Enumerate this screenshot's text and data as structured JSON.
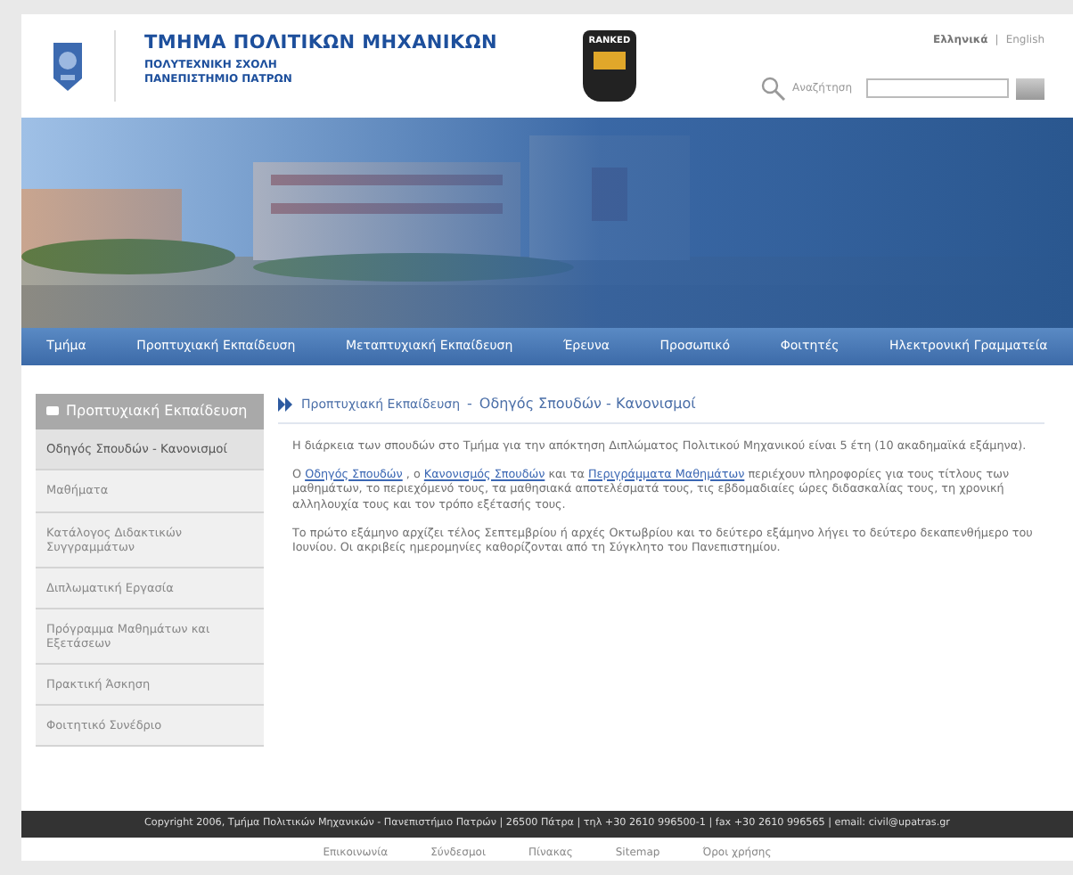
{
  "header": {
    "title": "ΤΜΗΜΑ ΠΟΛΙΤΙΚΩΝ ΜΗΧΑΝΙΚΩΝ",
    "subtitle_lines": [
      "ΠΟΛΥΤΕΧΝΙΚΗ ΣΧΟΛΗ",
      "ΠΑΝΕΠΙΣΤΗΜΙΟ ΠΑΤΡΩΝ"
    ],
    "badge": "RANKED",
    "languages": [
      {
        "label": "Ελληνικά",
        "selected": true
      },
      {
        "label": "English",
        "selected": false
      }
    ],
    "language_separator": "|",
    "search": {
      "label": "Αναζήτηση"
    }
  },
  "banner": {
    "kind": "picture"
  },
  "nav": [
    "Τμήμα",
    "Προπτυχιακή Εκπαίδευση",
    "Μεταπτυχιακή Εκπαίδευση",
    "Έρευνα",
    "Προσωπικό",
    "Φοιτητές",
    "Ηλεκτρονική Γραμματεία"
  ],
  "sidebar": {
    "title": "Προπτυχιακή Εκπαίδευση",
    "expanded": true,
    "items": [
      {
        "label": "Οδηγός Σπουδών - Κανονισμοί",
        "selected": true
      },
      {
        "label": "Μαθήματα",
        "selected": false
      },
      {
        "label": "Κατάλογος Διδακτικών Συγγραμμάτων",
        "selected": false
      },
      {
        "label": "Διπλωματική Εργασία",
        "selected": false
      },
      {
        "label": "Πρόγραμμα Μαθημάτων και Εξετάσεων",
        "selected": false
      },
      {
        "label": "Πρακτική Άσκηση",
        "selected": false
      },
      {
        "label": "Φοιτητικό Συνέδριο",
        "selected": false
      }
    ]
  },
  "breadcrumb_separator": "-",
  "breadcrumb": [
    {
      "label": "Προπτυχιακή Εκπαίδευση",
      "kind": "link"
    },
    {
      "label": "Οδηγός Σπουδών - Κανονισμοί",
      "kind": "current"
    }
  ],
  "paragraphs": [
    [
      {
        "kind": "text",
        "text": "Η διάρκεια των σπουδών στο Τμήμα για την απόκτηση Διπλώματος Πολιτικού Μηχανικού είναι 5 έτη (10 ακαδημαϊκά εξάμηνα)."
      }
    ],
    [
      {
        "kind": "text",
        "text": "Ο "
      },
      {
        "kind": "link",
        "text": "Οδηγός Σπουδών"
      },
      {
        "kind": "text",
        "text": " , ο "
      },
      {
        "kind": "link",
        "text": "Κανονισμός Σπουδών"
      },
      {
        "kind": "text",
        "text": " και τα "
      },
      {
        "kind": "link",
        "text": "Περιγράμματα Μαθημάτων"
      },
      {
        "kind": "text",
        "text": " περιέχουν πληροφορίες για τους τίτλους των μαθημάτων, το περιεχόμενό τους, τα μαθησιακά αποτελέσματά τους, τις εβδομαδιαίες ώρες διδασκαλίας τους, τη χρονική αλληλουχία τους και τον τρόπο εξέτασής τους."
      }
    ],
    [
      {
        "kind": "text",
        "text": "Το πρώτο εξάμηνο αρχίζει τέλος Σεπτεμβρίου ή αρχές Οκτωβρίου και το δεύτερο εξάμηνο λήγει το δεύτερο δεκαπενθήμερο του Ιουνίου. Οι ακριβείς ημερομηνίες καθορίζονται από τη Σύγκλητο του Πανεπιστημίου."
      }
    ]
  ],
  "footer": {
    "text": "Copyright 2006, Τμήμα Πολιτικών Μηχανικών - Πανεπιστήμιο Πατρών | 26500 Πάτρα | τηλ +30 2610 996500-1 | fax +30 2610 996565 | email: civil@upatras.gr",
    "links": [
      "Επικοινωνία",
      "Σύνδεσμοι",
      "Πίνακας",
      "Sitemap",
      "Όροι χρήσης"
    ]
  }
}
